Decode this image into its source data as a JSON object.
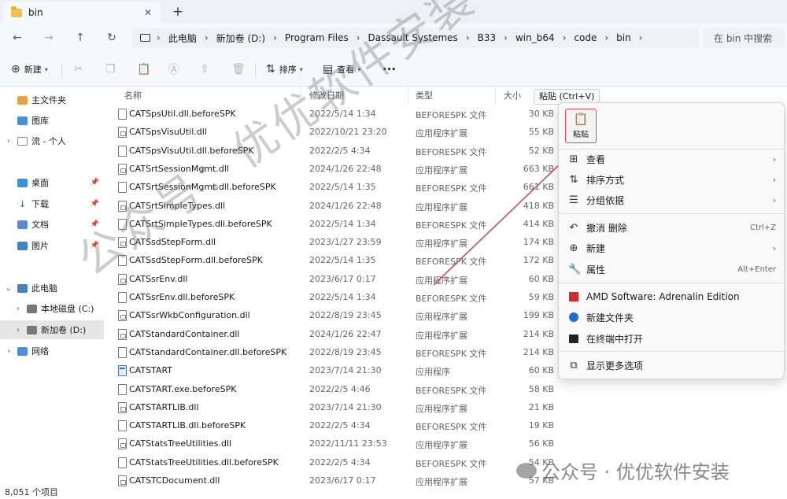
{
  "tab": {
    "title": "bin",
    "close": "✕",
    "new": "+"
  },
  "address": {
    "crumbs": [
      "此电脑",
      "新加卷 (D:)",
      "Program Files",
      "Dassault Systemes",
      "B33",
      "win_b64",
      "code",
      "bin"
    ],
    "search_placeholder": "在 bin 中搜索"
  },
  "toolbar": {
    "new_label": "新建",
    "sort_label": "排序",
    "view_label": "查看",
    "more_label": "···"
  },
  "sidebar": {
    "home": "主文件夹",
    "gallery": "图库",
    "personal": "流 - 个人",
    "desktop": "桌面",
    "downloads": "下载",
    "documents": "文档",
    "pictures": "图片",
    "this_pc": "此电脑",
    "drive_c": "本地磁盘 (C:)",
    "drive_d": "新加卷 (D:)",
    "network": "网络"
  },
  "columns": {
    "name": "名称",
    "date": "修改日期",
    "type": "类型",
    "size": "大小"
  },
  "files": [
    {
      "name": "CATSpsUtil.dll.beforeSPK",
      "date": "2022/5/14 1:34",
      "type": "BEFORESPK 文件",
      "size": "30 KB",
      "kind": "file"
    },
    {
      "name": "CATSpsVisuUtil.dll",
      "date": "2022/10/21 23:20",
      "type": "应用程序扩展",
      "size": "55 KB",
      "kind": "dll"
    },
    {
      "name": "CATSpsVisuUtil.dll.beforeSPK",
      "date": "2022/2/5 4:34",
      "type": "BEFORESPK 文件",
      "size": "52 KB",
      "kind": "file"
    },
    {
      "name": "CATSrtSessionMgmt.dll",
      "date": "2024/1/26 22:48",
      "type": "应用程序扩展",
      "size": "663 KB",
      "kind": "dll"
    },
    {
      "name": "CATSrtSessionMgmt.dll.beforeSPK",
      "date": "2022/5/14 1:35",
      "type": "BEFORESPK 文件",
      "size": "661 KB",
      "kind": "file"
    },
    {
      "name": "CATSrtSimpleTypes.dll",
      "date": "2024/1/26 22:48",
      "type": "应用程序扩展",
      "size": "418 KB",
      "kind": "dll"
    },
    {
      "name": "CATSrtSimpleTypes.dll.beforeSPK",
      "date": "2022/5/14 1:34",
      "type": "BEFORESPK 文件",
      "size": "414 KB",
      "kind": "file"
    },
    {
      "name": "CATSsdStepForm.dll",
      "date": "2023/1/27 23:59",
      "type": "应用程序扩展",
      "size": "174 KB",
      "kind": "dll"
    },
    {
      "name": "CATSsdStepForm.dll.beforeSPK",
      "date": "2022/5/14 1:35",
      "type": "BEFORESPK 文件",
      "size": "172 KB",
      "kind": "file"
    },
    {
      "name": "CATSsrEnv.dll",
      "date": "2023/6/17 0:17",
      "type": "应用程序扩展",
      "size": "60 KB",
      "kind": "dll"
    },
    {
      "name": "CATSsrEnv.dll.beforeSPK",
      "date": "2022/5/14 1:34",
      "type": "BEFORESPK 文件",
      "size": "59 KB",
      "kind": "file"
    },
    {
      "name": "CATSsrWkbConfiguration.dll",
      "date": "2022/8/19 23:45",
      "type": "应用程序扩展",
      "size": "199 KB",
      "kind": "dll"
    },
    {
      "name": "CATStandardContainer.dll",
      "date": "2024/1/26 22:47",
      "type": "应用程序扩展",
      "size": "214 KB",
      "kind": "dll"
    },
    {
      "name": "CATStandardContainer.dll.beforeSPK",
      "date": "2022/8/19 23:45",
      "type": "BEFORESPK 文件",
      "size": "214 KB",
      "kind": "file"
    },
    {
      "name": "CATSTART",
      "date": "2023/7/14 21:30",
      "type": "应用程序",
      "size": "60 KB",
      "kind": "exe"
    },
    {
      "name": "CATSTART.exe.beforeSPK",
      "date": "2022/2/5 4:46",
      "type": "BEFORESPK 文件",
      "size": "58 KB",
      "kind": "file"
    },
    {
      "name": "CATSTARTLIB.dll",
      "date": "2023/7/14 21:30",
      "type": "应用程序扩展",
      "size": "21 KB",
      "kind": "dll"
    },
    {
      "name": "CATSTARTLIB.dll.beforeSPK",
      "date": "2022/2/5 4:34",
      "type": "BEFORESPK 文件",
      "size": "19 KB",
      "kind": "file"
    },
    {
      "name": "CATStatsTreeUtilities.dll",
      "date": "2022/11/11 23:53",
      "type": "应用程序扩展",
      "size": "56 KB",
      "kind": "dll"
    },
    {
      "name": "CATStatsTreeUtilities.dll.beforeSPK",
      "date": "2022/2/5 4:34",
      "type": "BEFORESPK 文件",
      "size": "54 KB",
      "kind": "file"
    },
    {
      "name": "CATSTCDocument.dll",
      "date": "2023/6/17 0:17",
      "type": "应用程序扩展",
      "size": "57 KB",
      "kind": "dll"
    }
  ],
  "status": {
    "count": "8,051 个项目"
  },
  "context_menu": {
    "tooltip": "粘贴 (Ctrl+V)",
    "paste": "粘贴",
    "view": "查看",
    "sort": "排序方式",
    "group": "分组依据",
    "undo": "撤消 删除",
    "undo_shortcut": "Ctrl+Z",
    "new": "新建",
    "properties": "属性",
    "properties_shortcut": "Alt+Enter",
    "amd": "AMD Software: Adrenalin Edition",
    "new_folder": "新建文件夹",
    "terminal": "在终端中打开",
    "more": "显示更多选项"
  },
  "watermark": {
    "diagonal": "公众号：优优软件安装",
    "footer": "公众号 · 优优软件安装"
  },
  "colors": {
    "annotation": "#d34f4f",
    "folder": "#f2c14e",
    "selected": "#e6e6e6"
  }
}
